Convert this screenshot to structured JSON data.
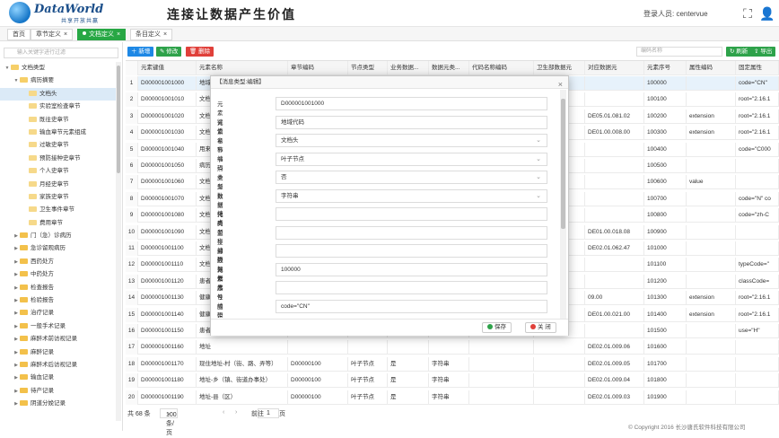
{
  "header": {
    "logo_name": "DataWorld",
    "logo_sub": "共享开放共赢",
    "slogan": "连接让数据产生价值",
    "login_label": "登录人员: centervue"
  },
  "tabs": [
    {
      "label": "首页"
    },
    {
      "label": "章节定义"
    },
    {
      "label": "文档定义"
    },
    {
      "label": "条目定义"
    }
  ],
  "sidebar": {
    "search_placeholder": "输入关键字进行过滤",
    "items": [
      {
        "label": "文档类型",
        "level": 0,
        "type": "folder",
        "open": true
      },
      {
        "label": "病历摘要",
        "level": 1,
        "type": "folder",
        "open": true
      },
      {
        "label": "文档头",
        "level": 2,
        "type": "file",
        "selected": true
      },
      {
        "label": "实验室检查章节",
        "level": 2,
        "type": "file"
      },
      {
        "label": "既往史章节",
        "level": 2,
        "type": "file"
      },
      {
        "label": "输血章节元素组成",
        "level": 2,
        "type": "file"
      },
      {
        "label": "过敏史章节",
        "level": 2,
        "type": "file"
      },
      {
        "label": "预防接种史章节",
        "level": 2,
        "type": "file"
      },
      {
        "label": "个人史章节",
        "level": 2,
        "type": "file"
      },
      {
        "label": "月经史章节",
        "level": 2,
        "type": "file"
      },
      {
        "label": "家族史章节",
        "level": 2,
        "type": "file"
      },
      {
        "label": "卫生事件章节",
        "level": 2,
        "type": "file"
      },
      {
        "label": "费用章节",
        "level": 2,
        "type": "file"
      },
      {
        "label": "门（急）诊病历",
        "level": 1,
        "type": "folder"
      },
      {
        "label": "急诊留观病历",
        "level": 1,
        "type": "folder"
      },
      {
        "label": "西药处方",
        "level": 1,
        "type": "folder"
      },
      {
        "label": "中药处方",
        "level": 1,
        "type": "folder"
      },
      {
        "label": "检查报告",
        "level": 1,
        "type": "folder"
      },
      {
        "label": "检验报告",
        "level": 1,
        "type": "folder"
      },
      {
        "label": "治疗记录",
        "level": 1,
        "type": "folder"
      },
      {
        "label": "一般手术记录",
        "level": 1,
        "type": "folder"
      },
      {
        "label": "麻醉术前访视记录",
        "level": 1,
        "type": "folder"
      },
      {
        "label": "麻醉记录",
        "level": 1,
        "type": "folder"
      },
      {
        "label": "麻醉术后访视记录",
        "level": 1,
        "type": "folder"
      },
      {
        "label": "输血记录",
        "level": 1,
        "type": "folder"
      },
      {
        "label": "待产记录",
        "level": 1,
        "type": "folder"
      },
      {
        "label": "阴道分娩记录",
        "level": 1,
        "type": "folder"
      }
    ]
  },
  "toolbar": {
    "add": "新增",
    "edit": "修改",
    "delete": "删除",
    "search_placeholder": "编码名称",
    "refresh": "刷新",
    "export": "导出"
  },
  "table": {
    "headers": [
      "",
      "元素键值",
      "元素名称",
      "章节编码",
      "节点类型",
      "业务数据...",
      "数据元类...",
      "代码名称编码",
      "卫生部数据元",
      "对应数据元",
      "元素序号",
      "属性编码",
      "固定属性"
    ],
    "rows": [
      [
        "1",
        "D000001001000",
        "地域",
        "",
        "",
        "",
        "",
        "",
        "",
        "",
        "100000",
        "",
        "code=\"CN\""
      ],
      [
        "2",
        "D000001001010",
        "文档",
        "",
        "",
        "",
        "",
        "",
        "",
        "",
        "100100",
        "",
        "root=\"2.16.1"
      ],
      [
        "3",
        "D000001001020",
        "文档",
        "",
        "",
        "",
        "",
        "",
        "",
        "DE05.01.081.02",
        "100200",
        "extension",
        "root=\"2.16.1"
      ],
      [
        "4",
        "D000001001030",
        "文档",
        "",
        "",
        "",
        "",
        "",
        "",
        "DE01.00.008.00",
        "100300",
        "extension",
        "root=\"2.16.1"
      ],
      [
        "5",
        "D000001001040",
        "用来",
        "",
        "",
        "",
        "",
        "",
        "",
        "",
        "100400",
        "",
        "code=\"C000"
      ],
      [
        "6",
        "D000001001050",
        "病历",
        "",
        "",
        "",
        "",
        "",
        "",
        "",
        "100500",
        "",
        ""
      ],
      [
        "7",
        "D000001001060",
        "文档",
        "",
        "",
        "",
        "",
        "",
        "",
        "",
        "100600",
        "value",
        ""
      ],
      [
        "8",
        "D000001001070",
        "文档",
        "",
        "",
        "",
        "",
        "",
        "",
        "",
        "100700",
        "",
        "code=\"N\" co"
      ],
      [
        "9",
        "D000001001080",
        "文档",
        "",
        "",
        "",
        "",
        "",
        "",
        "",
        "100800",
        "",
        "code=\"zh-C"
      ],
      [
        "10",
        "D000001001090",
        "文档",
        "",
        "",
        "",
        "",
        "",
        "",
        "DE01.00.018.08",
        "100900",
        "",
        ""
      ],
      [
        "11",
        "D000001001100",
        "文档",
        "",
        "",
        "",
        "",
        "",
        "",
        "DE02.01.062.47",
        "101000",
        "",
        ""
      ],
      [
        "12",
        "D000001001110",
        "文档",
        "",
        "",
        "",
        "",
        "",
        "",
        "",
        "101100",
        "",
        "typeCode=\""
      ],
      [
        "13",
        "D000001001120",
        "患者",
        "",
        "",
        "",
        "",
        "",
        "",
        "",
        "101200",
        "",
        "classCode="
      ],
      [
        "14",
        "D000001001130",
        "健康",
        "",
        "",
        "",
        "",
        "",
        "",
        "09.00",
        "101300",
        "extension",
        "root=\"2.16.1"
      ],
      [
        "15",
        "D000001001140",
        "健康",
        "",
        "",
        "",
        "",
        "",
        "",
        "DE01.00.021.00",
        "101400",
        "extension",
        "root=\"2.16.1"
      ],
      [
        "16",
        "D000001001150",
        "患者",
        "",
        "",
        "",
        "",
        "",
        "",
        "",
        "101500",
        "",
        "use=\"H\""
      ],
      [
        "17",
        "D000001001160",
        "地址",
        "",
        "",
        "",
        "",
        "",
        "",
        "DE02.01.009.06",
        "101600",
        "",
        ""
      ],
      [
        "18",
        "D000001001170",
        "现住地址-村（街、路、弄等）",
        "D00000100",
        "叶子节点",
        "是",
        "字符串",
        "",
        "",
        "DE02.01.009.05",
        "101700",
        "",
        ""
      ],
      [
        "19",
        "D000001001180",
        "地址-乡（镇、街道办事处）",
        "D00000100",
        "叶子节点",
        "是",
        "字符串",
        "",
        "",
        "DE02.01.009.04",
        "101800",
        "",
        ""
      ],
      [
        "20",
        "D000001001190",
        "地址-县（区）",
        "D00000100",
        "叶子节点",
        "是",
        "字符串",
        "",
        "",
        "DE02.01.009.03",
        "101900",
        "",
        ""
      ]
    ]
  },
  "pager": {
    "total": "共 68 条",
    "size": "100条/页",
    "prev": "前往",
    "page": "1",
    "suffix": "页"
  },
  "footer": "© Copyright 2016 长沙唐氏软件科技有限公司",
  "modal": {
    "title": "【消息类型:编辑】",
    "fields": [
      {
        "label": "元素键值",
        "value": "D000001001000",
        "type": "text"
      },
      {
        "label": "元素名称",
        "value": "地域代码",
        "type": "text"
      },
      {
        "label": "章节编码",
        "value": "文档头",
        "type": "select"
      },
      {
        "label": "节点类型",
        "value": "叶子节点",
        "type": "select"
      },
      {
        "label": "业务数据结点",
        "value": "否",
        "type": "select"
      },
      {
        "label": "数据元类型",
        "value": "字符串",
        "type": "select"
      },
      {
        "label": "代码名称编码",
        "value": "",
        "type": "text"
      },
      {
        "label": "卫生部数据元",
        "value": "",
        "type": "text"
      },
      {
        "label": "对应数据元",
        "value": "",
        "type": "text"
      },
      {
        "label": "元素序号",
        "value": "100000",
        "type": "text"
      },
      {
        "label": "属性编码",
        "value": "",
        "type": "text"
      },
      {
        "label": "固定属性",
        "value": "code=\"CN\"",
        "type": "text"
      },
      {
        "label": "元素值对应元素",
        "value": "",
        "type": "text"
      }
    ],
    "save": "保存",
    "close": "关 闭"
  },
  "colors": {
    "green": "#27a744",
    "blue": "#1e88e5",
    "red": "#e0403a"
  }
}
